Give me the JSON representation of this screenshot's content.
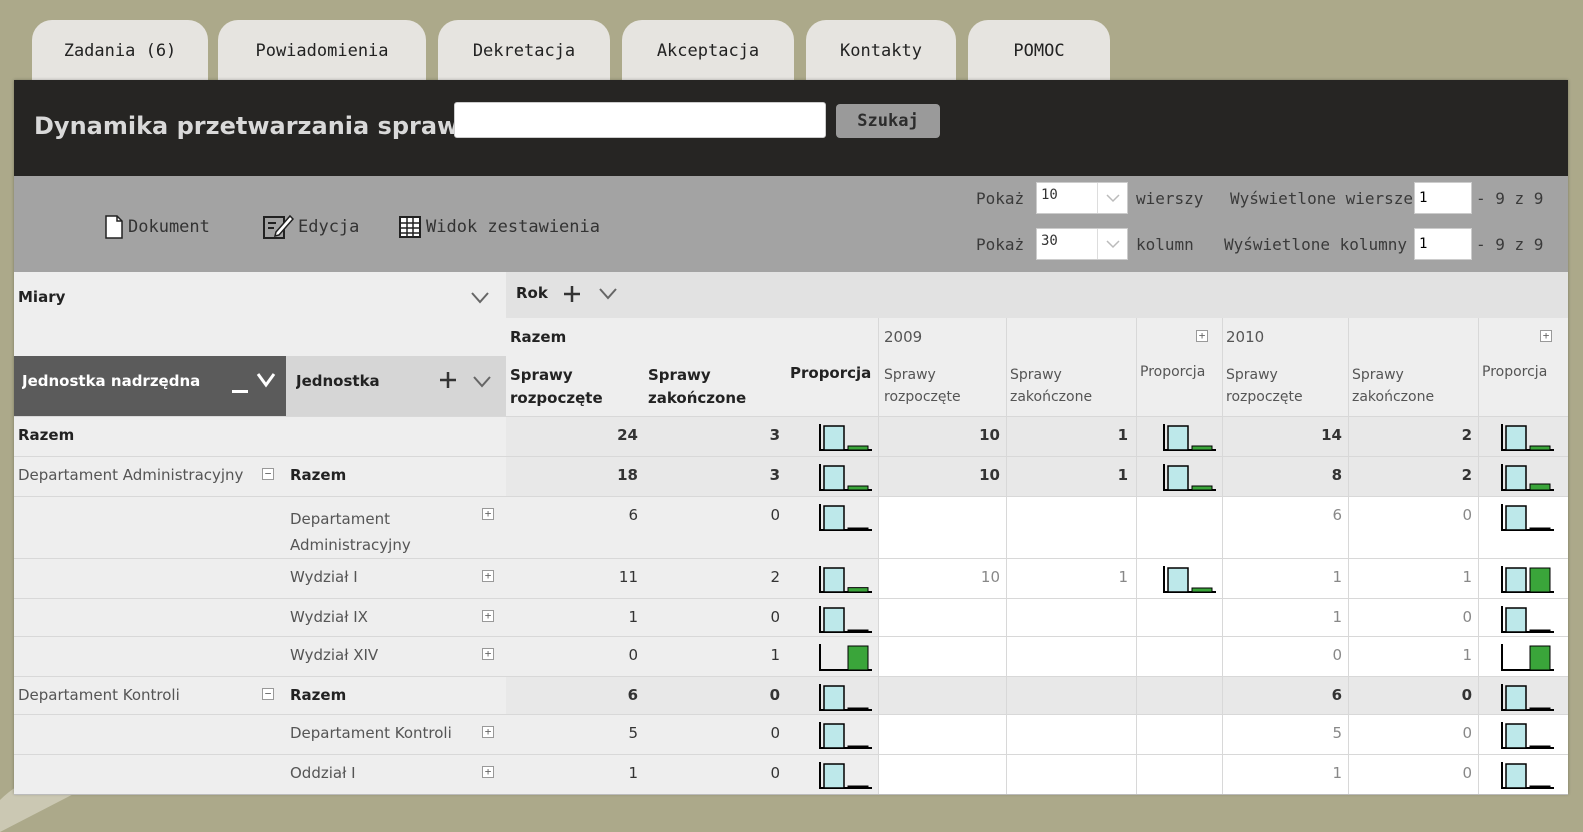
{
  "tabs": [
    "Zadania (6)",
    "Powiadomienia",
    "Dekretacja",
    "Akceptacja",
    "Kontakty",
    "POMOC"
  ],
  "page_title": "Dynamika przetwarzania spraw",
  "search": {
    "value": "",
    "button": "Szukaj"
  },
  "toolbar": {
    "document": "Dokument",
    "edit": "Edycja",
    "summary": "Widok zestawienia"
  },
  "paging": {
    "show_label": "Pokaż",
    "rows_value": "10",
    "rows_unit": "wierszy",
    "cols_value": "30",
    "cols_unit": "kolumn",
    "displayed_rows_label": "Wyświetlone wiersze",
    "displayed_rows_value": "1",
    "displayed_rows_suffix": "- 9 z 9",
    "displayed_cols_label": "Wyświetlone kolumny",
    "displayed_cols_value": "1",
    "displayed_cols_suffix": "- 9 z 9"
  },
  "measures_label": "Miary",
  "column_dimension": "Rok",
  "row_dims": {
    "parent": "Jednostka nadrzędna",
    "unit": "Jednostka"
  },
  "column_groups": {
    "total": "Razem",
    "y2009": "2009",
    "y2010": "2010"
  },
  "measure_headers": {
    "started": [
      "Sprawy",
      "rozpoczęte"
    ],
    "finished": [
      "Sprawy",
      "zakończone"
    ],
    "proportion": "Proporcja"
  },
  "row_labels": {
    "grand_total": "Razem",
    "dept_admin": "Departament Administracyjny",
    "dept_admin_total": "Razem",
    "dept_admin_unit": [
      "Departament",
      "Administracyjny"
    ],
    "wydzial_i": "Wydział I",
    "wydzial_ix": "Wydział IX",
    "wydzial_xiv": "Wydział XIV",
    "dept_kontroli": "Departament Kontroli",
    "dept_kontroli_total": "Razem",
    "dept_kontroli_unit": "Departament Kontroli",
    "oddzial_i": "Oddział I"
  },
  "rows": [
    {
      "id": "grand_total",
      "total": [
        24,
        3
      ],
      "y2009": [
        10,
        1
      ],
      "y2010": [
        14,
        2
      ]
    },
    {
      "id": "dept_admin_total",
      "total": [
        18,
        3
      ],
      "y2009": [
        10,
        1
      ],
      "y2010": [
        8,
        2
      ]
    },
    {
      "id": "dept_admin_unit",
      "total": [
        6,
        0
      ],
      "y2009": null,
      "y2010": [
        6,
        0
      ]
    },
    {
      "id": "wydzial_i",
      "total": [
        11,
        2
      ],
      "y2009": [
        10,
        1
      ],
      "y2010": [
        1,
        1
      ]
    },
    {
      "id": "wydzial_ix",
      "total": [
        1,
        0
      ],
      "y2009": null,
      "y2010": [
        1,
        0
      ]
    },
    {
      "id": "wydzial_xiv",
      "total": [
        0,
        1
      ],
      "y2009": null,
      "y2010": [
        0,
        1
      ]
    },
    {
      "id": "dept_kontroli_total",
      "total": [
        6,
        0
      ],
      "y2009": null,
      "y2010": [
        6,
        0
      ]
    },
    {
      "id": "dept_kontroli_unit",
      "total": [
        5,
        0
      ],
      "y2009": null,
      "y2010": [
        5,
        0
      ]
    },
    {
      "id": "oddzial_i",
      "total": [
        1,
        0
      ],
      "y2009": null,
      "y2010": [
        1,
        0
      ]
    }
  ],
  "colors": {
    "started_bar": "#bde8ea",
    "finished_bar": "#3aa53a",
    "titlebar": "#262523",
    "toolbar": "#a3a3a3"
  }
}
